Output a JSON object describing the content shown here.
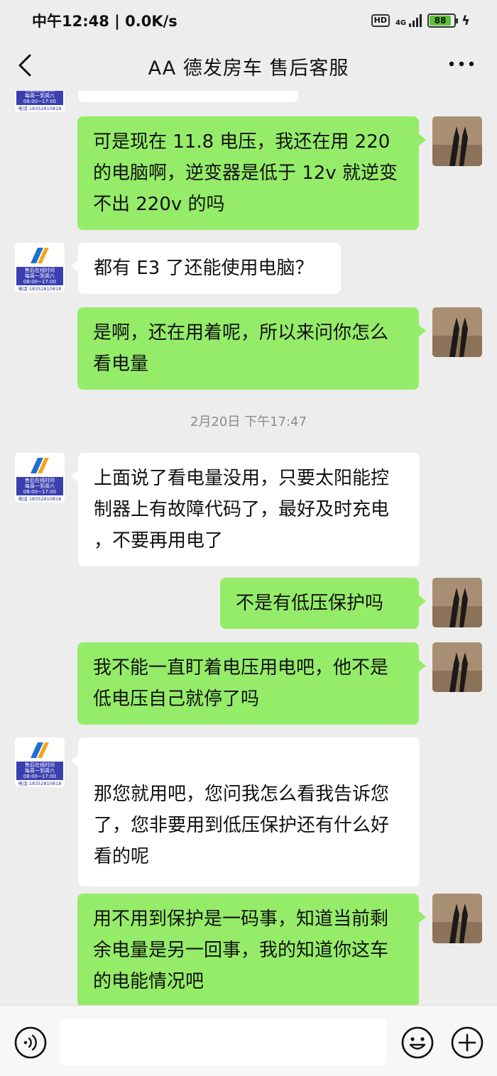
{
  "status_bar": {
    "time": "中午12:48 | 0.0K/s",
    "hd": "HD",
    "network": "4G",
    "battery": "88"
  },
  "header": {
    "title": "AA 德发房车 售后客服"
  },
  "service_avatar": {
    "line1": "售后在线时间",
    "line2": "每周一到周六",
    "line3": "08:00~17:00",
    "phone": "电话:18352810818"
  },
  "messages": [
    {
      "sender": "me",
      "text": "可是现在 11.8 电压，我还在用 220 的电脑啊，逆变器是低于 12v 就逆变不出 220v 的吗"
    },
    {
      "sender": "them",
      "text": "都有 E3 了还能使用电脑？"
    },
    {
      "sender": "me",
      "text": "是啊，还在用着呢，所以来问你怎么看电量"
    },
    {
      "sender": "them",
      "text": "上面说了看电量没用，只要太阳能控制器上有故障代码了，最好及时充电 ，不要再用电了"
    },
    {
      "sender": "me",
      "text": "不是有低压保护吗"
    },
    {
      "sender": "me",
      "text": "我不能一直盯着电压用电吧，他不是低电压自己就停了吗"
    },
    {
      "sender": "them",
      "text": "那您就用吧，您问我怎么看我告诉您了，您非要用到低压保护还有什么好看的呢"
    },
    {
      "sender": "me",
      "text": "用不用到保护是一码事，知道当前剩余电量是另一回事，我的知道你这车的电能情况吧"
    }
  ],
  "timestamp": "2月20日 下午17:47",
  "colors": {
    "my_bubble": "#95ec69",
    "their_bubble": "#ffffff",
    "background": "#ededed"
  },
  "icons": {
    "back": "chevron-left-icon",
    "more": "more-dots-icon",
    "voice": "voice-icon",
    "emoji": "emoji-icon",
    "plus": "plus-icon"
  }
}
